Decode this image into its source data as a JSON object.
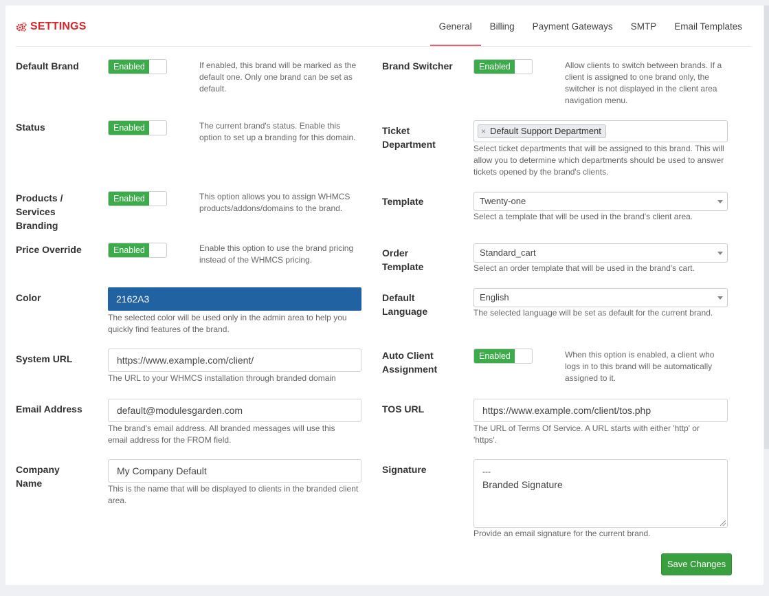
{
  "header": {
    "title": "SETTINGS",
    "title_icon": "cogs-icon",
    "accent_color": "#d8262b",
    "tabs": [
      {
        "label": "General",
        "active": true
      },
      {
        "label": "Billing",
        "active": false
      },
      {
        "label": "Payment Gateways",
        "active": false
      },
      {
        "label": "SMTP",
        "active": false
      },
      {
        "label": "Email Templates",
        "active": false
      }
    ]
  },
  "left": {
    "default_brand": {
      "label": "Default Brand",
      "toggle": "Enabled",
      "help": "If enabled, this brand will be marked as the default one. Only one brand can be set as default."
    },
    "status": {
      "label": "Status",
      "toggle": "Enabled",
      "help": "The current brand's status. Enable this option to set up a branding for this domain."
    },
    "products_branding": {
      "label": "Products / Services Branding",
      "toggle": "Enabled",
      "help": "This option allows you to assign WHMCS products/addons/domains to the brand."
    },
    "price_override": {
      "label": "Price Override",
      "toggle": "Enabled",
      "help": "Enable this option to use the brand pricing instead of the WHMCS pricing."
    },
    "color": {
      "label": "Color",
      "value": "2162A3",
      "swatch": "#2162a3",
      "help": "The selected color will be used only in the admin area to help you quickly find features of the brand."
    },
    "system_url": {
      "label": "System URL",
      "value": "https://www.example.com/client/",
      "help": "The URL to your WHMCS installation through branded domain"
    },
    "email_address": {
      "label": "Email Address",
      "value": "default@modulesgarden.com",
      "help": "The brand's email address. All branded messages will use this email address for the FROM field."
    },
    "company_name": {
      "label": "Company Name",
      "value": "My Company Default",
      "help": "This is the name that will be displayed to clients in the branded client area."
    }
  },
  "right": {
    "brand_switcher": {
      "label": "Brand Switcher",
      "toggle": "Enabled",
      "help": "Allow clients to switch between brands. If a client is assigned to one brand only, the switcher is not displayed in the client area navigation menu."
    },
    "ticket_department": {
      "label": "Ticket Department",
      "chip": "Default Support Department",
      "chip_remove": "×",
      "help": "Select ticket departments that will be assigned to this brand. This will allow you to determine which departments should be used to answer tickets opened by the brand's clients."
    },
    "template": {
      "label": "Template",
      "value": "Twenty-one",
      "help": "Select a template that will be used in the brand's client area."
    },
    "order_template": {
      "label": "Order Template",
      "value": "Standard_cart",
      "help": "Select an order template that will be used in the brand's cart."
    },
    "default_language": {
      "label": "Default Language",
      "value": "English",
      "help": "The selected language will be set as default for the current brand."
    },
    "auto_client_assignment": {
      "label": "Auto Client Assignment",
      "toggle": "Enabled",
      "help": "When this option is enabled, a client who logs in to this brand will be automatically assigned to it."
    },
    "tos_url": {
      "label": "TOS URL",
      "value": "https://www.example.com/client/tos.php",
      "help": "The URL of Terms Of Service. A URL starts with either 'http' or 'https'."
    },
    "signature": {
      "label": "Signature",
      "line1": "---",
      "line2": "Branded Signature",
      "help": "Provide an email signature for the current brand."
    }
  },
  "actions": {
    "save_label": "Save Changes"
  },
  "colors": {
    "toggle_on": "#3cac4a",
    "save_button": "#3a9f3e",
    "tab_underline": "#e35d6a"
  }
}
